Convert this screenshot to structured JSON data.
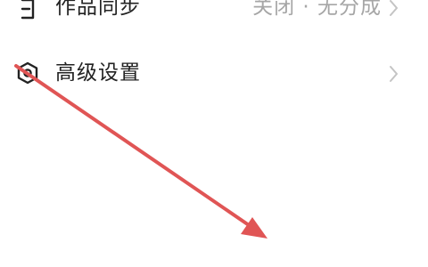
{
  "settings": {
    "items": [
      {
        "label": "作品同步",
        "value": "关闭 · 无分成",
        "icon": "sync-document-icon"
      },
      {
        "label": "高级设置",
        "value": "",
        "icon": "settings-hexagon-icon"
      }
    ]
  },
  "colors": {
    "label": "#222222",
    "value": "#a6a6a6",
    "chevron": "#c4c4c4",
    "annotation_arrow": "#e05555"
  }
}
